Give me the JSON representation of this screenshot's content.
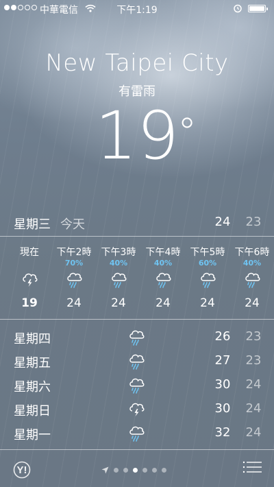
{
  "status_bar": {
    "carrier": "中華電信",
    "time": "下午1:19",
    "signal_bars": 2,
    "icons": [
      "wifi-icon",
      "alarm-clock-icon",
      "battery-icon"
    ]
  },
  "location": {
    "city": "New Taipei City",
    "condition": "有雷雨",
    "temperature": "19"
  },
  "today": {
    "day": "星期三",
    "label": "今天",
    "high": "24",
    "low": "23"
  },
  "hourly": [
    {
      "time": "現在",
      "precip": "",
      "icon": "thunderstorm-icon",
      "temp": "19"
    },
    {
      "time": "下午2時",
      "precip": "70%",
      "icon": "rain-icon",
      "temp": "24"
    },
    {
      "time": "下午3時",
      "precip": "40%",
      "icon": "rain-icon",
      "temp": "24"
    },
    {
      "time": "下午4時",
      "precip": "40%",
      "icon": "rain-icon",
      "temp": "24"
    },
    {
      "time": "下午5時",
      "precip": "60%",
      "icon": "rain-icon",
      "temp": "24"
    },
    {
      "time": "下午6時",
      "precip": "40%",
      "icon": "rain-icon",
      "temp": "24"
    }
  ],
  "daily": [
    {
      "day": "星期四",
      "icon": "rain-icon",
      "high": "26",
      "low": "23"
    },
    {
      "day": "星期五",
      "icon": "rain-icon",
      "high": "27",
      "low": "23"
    },
    {
      "day": "星期六",
      "icon": "rain-icon",
      "high": "30",
      "low": "24"
    },
    {
      "day": "星期日",
      "icon": "thunderstorm-icon",
      "high": "30",
      "low": "24"
    },
    {
      "day": "星期一",
      "icon": "rain-icon",
      "high": "32",
      "low": "24"
    }
  ],
  "bottom_bar": {
    "logo": "Y!",
    "page_count": 6,
    "active_page": 3,
    "icons": [
      "yahoo-logo",
      "location-arrow-icon",
      "list-icon"
    ]
  },
  "colors": {
    "precip": "#6fc4f2",
    "text": "#ffffff"
  }
}
